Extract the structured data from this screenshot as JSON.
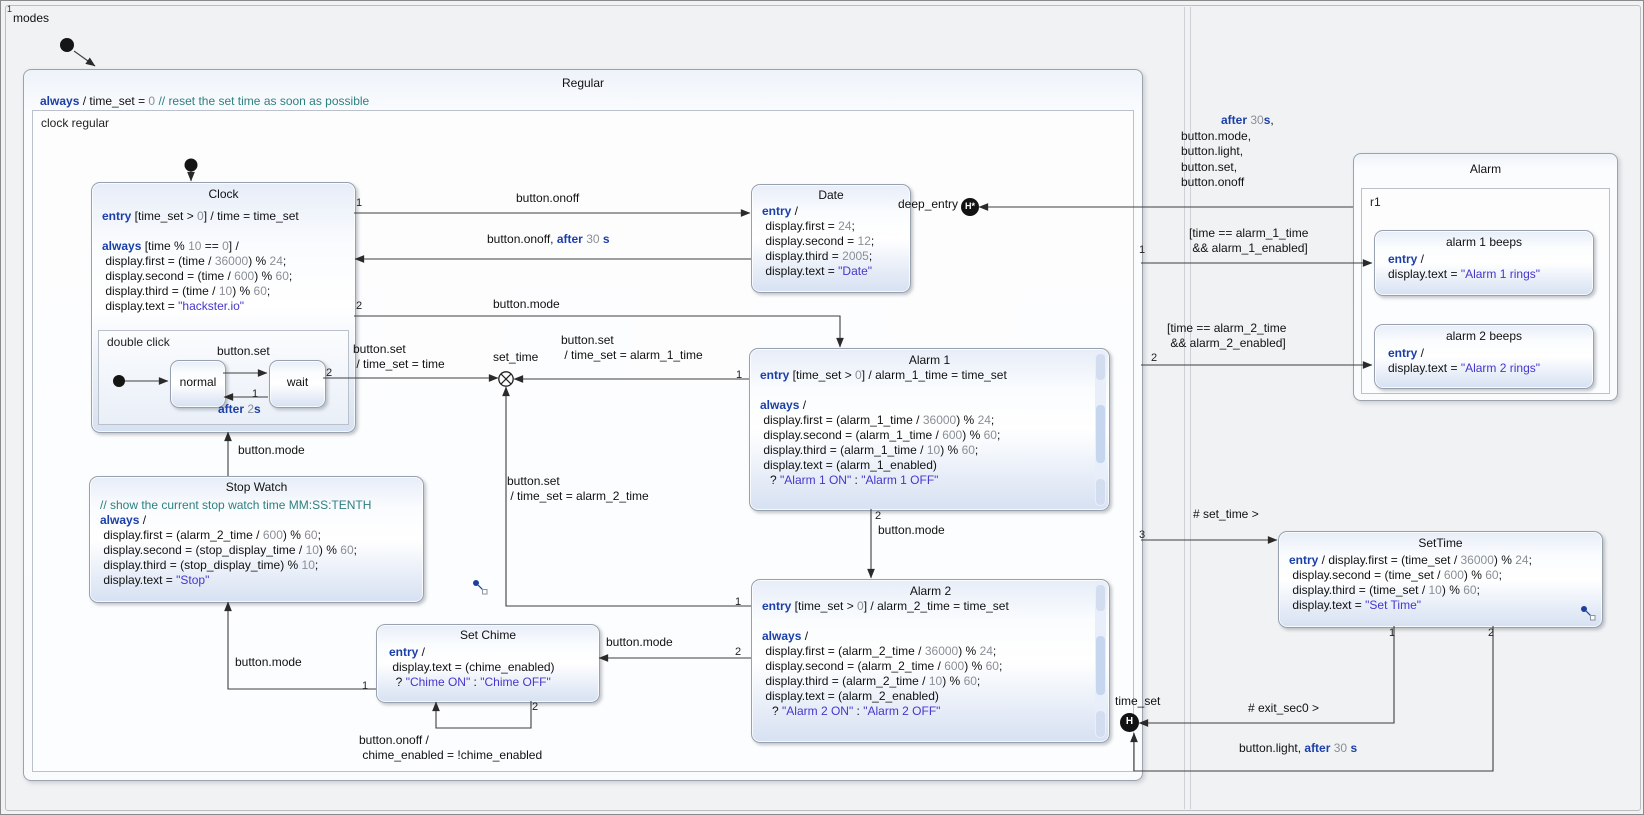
{
  "root": {
    "region_priority": "1",
    "region_label": "modes"
  },
  "colors": {
    "keyword_blue": "#1b3fa8",
    "string_violet": "#4636cc",
    "comment_teal": "#2e8080",
    "number_gray": "#8a8f96",
    "state_border": "#98a2ae",
    "state_fill_top": "#e7edf8",
    "state_fill_bottom": "#d6e1f2",
    "edge_color": "#3f3f3f",
    "canvas_bg": "#f1f2f4"
  },
  "regular": {
    "title": "Regular",
    "reaction": [
      "k:always",
      "p: / time_set = ",
      "n:0",
      "p: ",
      "c:// reset the set time as soon as possible"
    ],
    "region_label": "clock regular"
  },
  "clock": {
    "title": "Clock",
    "body": [
      [
        "k:entry",
        "p: [time_set > ",
        "n:0",
        "p:] / time = time_set"
      ],
      [],
      [
        "k:always",
        "p: [time % ",
        "n:10",
        "p: == ",
        "n:0",
        "p:] /"
      ],
      [
        "p: display.first = (time / ",
        "n:36000",
        "p:) % ",
        "n:24",
        "p:;"
      ],
      [
        "p: display.second = (time / ",
        "n:600",
        "p:) % ",
        "n:60",
        "p:;"
      ],
      [
        "p: display.third = (time / ",
        "n:10",
        "p:) % ",
        "n:60",
        "p:;"
      ],
      [
        "p: display.text = ",
        "s:\"hackster.io\""
      ]
    ],
    "region_label": "double click",
    "normal": "normal",
    "wait": "wait"
  },
  "date": {
    "title": "Date",
    "body": [
      [
        "k:entry",
        "p: /"
      ],
      [
        "p: display.first = ",
        "n:24",
        "p:;"
      ],
      [
        "p: display.second = ",
        "n:12",
        "p:;"
      ],
      [
        "p: display.third = ",
        "n:2005",
        "p:;"
      ],
      [
        "p: display.text = ",
        "s:\"Date\""
      ]
    ]
  },
  "alarm1": {
    "title": "Alarm 1",
    "body": [
      [
        "k:entry",
        "p: [time_set > ",
        "n:0",
        "p:] / alarm_1_time = time_set"
      ],
      [],
      [
        "k:always",
        "p: /"
      ],
      [
        "p: display.first = (alarm_1_time / ",
        "n:36000",
        "p:) % ",
        "n:24",
        "p:;"
      ],
      [
        "p: display.second = (alarm_1_time / ",
        "n:600",
        "p:) % ",
        "n:60",
        "p:;"
      ],
      [
        "p: display.third = (alarm_1_time / ",
        "n:10",
        "p:) % ",
        "n:60",
        "p:;"
      ],
      [
        "p: display.text = (alarm_1_enabled)"
      ],
      [
        "p:   ? ",
        "s:\"Alarm 1 ON\"",
        "p: : ",
        "s:\"Alarm 1 OFF\""
      ]
    ]
  },
  "alarm2": {
    "title": "Alarm 2",
    "body": [
      [
        "k:entry",
        "p: [time_set > ",
        "n:0",
        "p:] / alarm_2_time = time_set"
      ],
      [],
      [
        "k:always",
        "p: /"
      ],
      [
        "p: display.first = (alarm_2_time / ",
        "n:36000",
        "p:) % ",
        "n:24",
        "p:;"
      ],
      [
        "p: display.second = (alarm_2_time / ",
        "n:600",
        "p:) % ",
        "n:60",
        "p:;"
      ],
      [
        "p: display.third = (alarm_2_time / ",
        "n:10",
        "p:) % ",
        "n:60",
        "p:;"
      ],
      [
        "p: display.text = (alarm_2_enabled)"
      ],
      [
        "p:   ? ",
        "s:\"Alarm 2 ON\"",
        "p: : ",
        "s:\"Alarm 2 OFF\""
      ]
    ]
  },
  "stopwatch": {
    "title": "Stop Watch",
    "body": [
      [
        "c:// show the current stop watch time MM:SS:TENTH"
      ],
      [
        "k:always",
        "p: /"
      ],
      [
        "p: display.first = (alarm_2_time / ",
        "n:600",
        "p:) % ",
        "n:60",
        "p:;"
      ],
      [
        "p: display.second = (stop_display_time / ",
        "n:10",
        "p:) % ",
        "n:60",
        "p:;"
      ],
      [
        "p: display.third = (stop_display_time) % ",
        "n:10",
        "p:;"
      ],
      [
        "p: display.text = ",
        "s:\"Stop\""
      ]
    ]
  },
  "setchime": {
    "title": "Set Chime",
    "body": [
      [
        "k:entry",
        "p: /"
      ],
      [
        "p: display.text = (chime_enabled)"
      ],
      [
        "p:  ? ",
        "s:\"Chime ON\"",
        "p: : ",
        "s:\"Chime OFF\""
      ]
    ]
  },
  "settime": {
    "title": "SetTime",
    "body": [
      [
        "k:entry",
        "p: / display.first = (time_set / ",
        "n:36000",
        "p:) % ",
        "n:24",
        "p:;"
      ],
      [
        "p: display.second = (time_set / ",
        "n:600",
        "p:) % ",
        "n:60",
        "p:;"
      ],
      [
        "p: display.third = (time_set / ",
        "n:10",
        "p:) % ",
        "n:60",
        "p:;"
      ],
      [
        "p: display.text = ",
        "s:\"Set Time\""
      ]
    ]
  },
  "alarm": {
    "title": "Alarm",
    "region_label": "r1",
    "beeps1": {
      "title": "alarm 1 beeps",
      "body": [
        [
          "k:entry",
          "p: /"
        ],
        [
          "p:display.text = ",
          "s:\"Alarm 1 rings\""
        ]
      ]
    },
    "beeps2": {
      "title": "alarm 2 beeps",
      "body": [
        [
          "k:entry",
          "p: /"
        ],
        [
          "p:display.text = ",
          "s:\"Alarm 2 rings\""
        ]
      ]
    }
  },
  "pseudo": {
    "deep_entry": "deep_entry",
    "set_time": "set_time",
    "time_set": "time_set",
    "h_star": "H*",
    "h": "H"
  },
  "transitions": {
    "clock_date": {
      "label": [
        "p:button.onoff"
      ],
      "priority": "1"
    },
    "date_clock": {
      "label": [
        "p:button.onoff, ",
        "k:after",
        "p: ",
        "n:30",
        "p: ",
        "k:s"
      ]
    },
    "clock_alarm1": {
      "label": [
        "p:button.mode"
      ],
      "priority": "2"
    },
    "normal_wait": {
      "label": [
        "p:button.set"
      ]
    },
    "wait_normal": {
      "label": [
        "k:after",
        "p: ",
        "n:2",
        "k:s"
      ],
      "priority": "1"
    },
    "wait_exit": {
      "lines": [
        [
          "p:button.set"
        ],
        [
          "p: / time_set = time"
        ]
      ],
      "priority": "2"
    },
    "alarm1_exit": {
      "lines": [
        [
          "p:button.set"
        ],
        [
          "p: / time_set = alarm_1_time"
        ]
      ],
      "priority": "1"
    },
    "alarm2_exit": {
      "lines": [
        [
          "p:button.set"
        ],
        [
          "p: / time_set = alarm_2_time"
        ]
      ],
      "priority": "1"
    },
    "alarm1_alarm2": {
      "label": [
        "p:button.mode"
      ],
      "priority": "2"
    },
    "alarm2_setchime": {
      "label": [
        "p:button.mode"
      ],
      "priority": "2"
    },
    "setchime_stopwatch": {
      "label": [
        "p:button.mode"
      ],
      "priority": "1"
    },
    "setchime_self": {
      "lines": [
        [
          "p:button.onoff /"
        ],
        [
          "p: chime_enabled = !chime_enabled"
        ]
      ],
      "priority": "2"
    },
    "stopwatch_clock": {
      "label": [
        "p:button.mode"
      ]
    },
    "alarm_deepentry": {
      "lines": [
        [
          "k:after",
          "p: ",
          "n:30",
          "k:s",
          "p:,"
        ],
        [
          "p:button.mode,"
        ],
        [
          "p:button.light,"
        ],
        [
          "p:button.set,"
        ],
        [
          "p:button.onoff"
        ]
      ]
    },
    "reg_beeps1": {
      "lines": [
        [
          "p:[time == alarm_1_time"
        ],
        [
          "p: && alarm_1_enabled]"
        ]
      ],
      "priority": "1"
    },
    "reg_beeps2": {
      "lines": [
        [
          "p:[time == alarm_2_time"
        ],
        [
          "p: && alarm_2_enabled]"
        ]
      ],
      "priority": "2"
    },
    "reg_settime": {
      "label": [
        "p:# set_time >"
      ],
      "priority": "3"
    },
    "settime_exit": {
      "label": [
        "p:# exit_sec0 >"
      ],
      "priority": "1"
    },
    "settime_light": {
      "label": [
        "p:button.light, ",
        "k:after",
        "p: ",
        "n:30",
        "p: ",
        "k:s"
      ],
      "priority": "2"
    }
  }
}
